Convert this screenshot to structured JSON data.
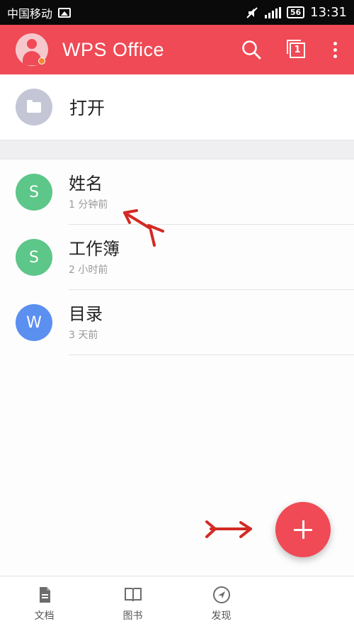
{
  "status_bar": {
    "carrier": "中国移动",
    "battery": "56",
    "time": "13:31"
  },
  "app_bar": {
    "title": "WPS Office",
    "tab_count": "1"
  },
  "open_row": {
    "label": "打开"
  },
  "files": [
    {
      "letter": "S",
      "name": "姓名",
      "time": "1 分钟前",
      "color": "#5dc689"
    },
    {
      "letter": "S",
      "name": "工作簿",
      "time": "2 小时前",
      "color": "#5dc689"
    },
    {
      "letter": "W",
      "name": "目录",
      "time": "3 天前",
      "color": "#5b8ff0"
    }
  ],
  "bottom_nav": {
    "items": [
      {
        "label": "文档",
        "icon": "document-icon"
      },
      {
        "label": "图书",
        "icon": "book-icon"
      },
      {
        "label": "发现",
        "icon": "compass-icon"
      }
    ]
  },
  "colors": {
    "accent": "#ef4a55",
    "annotation_arrow": "#d32a24"
  }
}
